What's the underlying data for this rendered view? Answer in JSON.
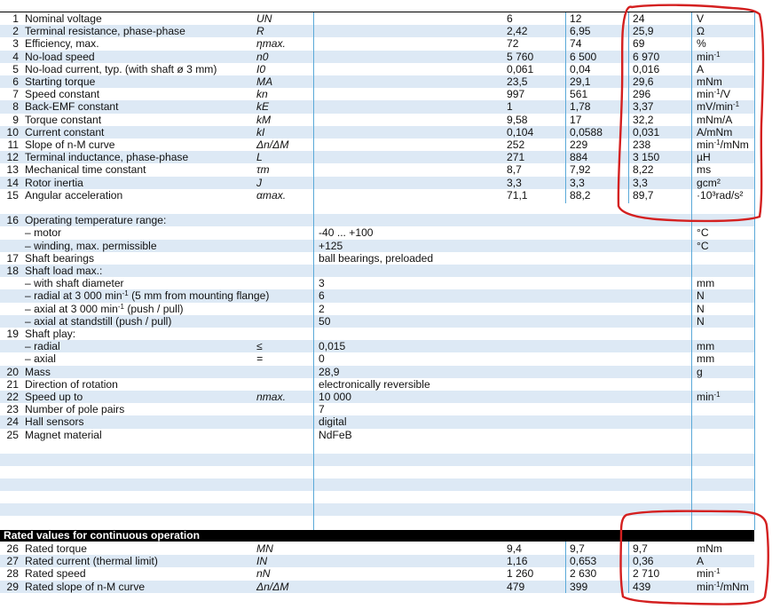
{
  "rows_top": [
    {
      "no": "1",
      "label": "Nominal voltage",
      "sym": "UN",
      "mid": "",
      "v1": "6",
      "v2": "12",
      "v3": "24",
      "unit": "V"
    },
    {
      "no": "2",
      "label": "Terminal resistance, phase-phase",
      "sym": "R",
      "mid": "",
      "v1": "2,42",
      "v2": "6,95",
      "v3": "25,9",
      "unit": "Ω"
    },
    {
      "no": "3",
      "label": "Efficiency, max.",
      "sym": "ηmax.",
      "mid": "",
      "v1": "72",
      "v2": "74",
      "v3": "69",
      "unit": "%"
    },
    {
      "no": "4",
      "label": "No-load speed",
      "sym": "n0",
      "mid": "",
      "v1": "5 760",
      "v2": "6 500",
      "v3": "6 970",
      "unit": "min-1"
    },
    {
      "no": "5",
      "label": "No-load current, typ. (with shaft ø 3 mm)",
      "sym": "I0",
      "mid": "",
      "v1": "0,061",
      "v2": "0,04",
      "v3": "0,016",
      "unit": "A"
    },
    {
      "no": "6",
      "label": "Starting torque",
      "sym": "MA",
      "mid": "",
      "v1": "23,5",
      "v2": "29,1",
      "v3": "29,6",
      "unit": "mNm"
    },
    {
      "no": "7",
      "label": "Speed constant",
      "sym": "kn",
      "mid": "",
      "v1": "997",
      "v2": "561",
      "v3": "296",
      "unit": "min-1/V"
    },
    {
      "no": "8",
      "label": "Back-EMF constant",
      "sym": "kE",
      "mid": "",
      "v1": "1",
      "v2": "1,78",
      "v3": "3,37",
      "unit": "mV/min-1"
    },
    {
      "no": "9",
      "label": "Torque constant",
      "sym": "kM",
      "mid": "",
      "v1": "9,58",
      "v2": "17",
      "v3": "32,2",
      "unit": "mNm/A"
    },
    {
      "no": "10",
      "label": "Current constant",
      "sym": "kI",
      "mid": "",
      "v1": "0,104",
      "v2": "0,0588",
      "v3": "0,031",
      "unit": "A/mNm"
    },
    {
      "no": "11",
      "label": "Slope of n-M curve",
      "sym": "Δn/ΔM",
      "mid": "",
      "v1": "252",
      "v2": "229",
      "v3": "238",
      "unit": "min-1/mNm"
    },
    {
      "no": "12",
      "label": "Terminal inductance, phase-phase",
      "sym": "L",
      "mid": "",
      "v1": "271",
      "v2": "884",
      "v3": "3 150",
      "unit": "µH"
    },
    {
      "no": "13",
      "label": "Mechanical time constant",
      "sym": "τm",
      "mid": "",
      "v1": "8,7",
      "v2": "7,92",
      "v3": "8,22",
      "unit": "ms"
    },
    {
      "no": "14",
      "label": "Rotor inertia",
      "sym": "J",
      "mid": "",
      "v1": "3,3",
      "v2": "3,3",
      "v3": "3,3",
      "unit": "gcm²"
    },
    {
      "no": "15",
      "label": "Angular acceleration",
      "sym": "αmax.",
      "mid": "",
      "v1": "71,1",
      "v2": "88,2",
      "v3": "89,7",
      "unit": "·10³rad/s²"
    }
  ],
  "rows_mid": [
    {
      "no": "",
      "label": "",
      "sym": "",
      "mid": "",
      "unit": ""
    },
    {
      "no": "16",
      "label": "Operating temperature range:",
      "sym": "",
      "mid": "",
      "unit": ""
    },
    {
      "no": "",
      "label": "– motor",
      "sym": "",
      "mid": "-40 ... +100",
      "unit": "°C"
    },
    {
      "no": "",
      "label": "– winding, max. permissible",
      "sym": "",
      "mid": "              +125",
      "unit": "°C"
    },
    {
      "no": "17",
      "label": "Shaft bearings",
      "sym": "",
      "mid": "ball bearings, preloaded",
      "unit": ""
    },
    {
      "no": "18",
      "label": "Shaft load max.:",
      "sym": "",
      "mid": "",
      "unit": ""
    },
    {
      "no": "",
      "label": "– with shaft diameter",
      "sym": "",
      "mid": "3",
      "unit": "mm"
    },
    {
      "no": "",
      "label": "– radial at 3 000 min-1 (5 mm from mounting flange)",
      "sym": "",
      "mid": "6",
      "unit": "N"
    },
    {
      "no": "",
      "label": "– axial at 3 000 min-1 (push / pull)",
      "sym": "",
      "mid": "2",
      "unit": "N"
    },
    {
      "no": "",
      "label": "– axial at standstill (push / pull)",
      "sym": "",
      "mid": "50",
      "unit": "N"
    },
    {
      "no": "19",
      "label": "Shaft play:",
      "sym": "",
      "mid": "",
      "unit": ""
    },
    {
      "no": "",
      "label": "– radial",
      "sym": "≤",
      "mid": "0,015",
      "unit": "mm"
    },
    {
      "no": "",
      "label": "– axial",
      "sym": "=",
      "mid": "0",
      "unit": "mm"
    },
    {
      "no": "20",
      "label": "Mass",
      "sym": "",
      "mid": "28,9",
      "unit": "g"
    },
    {
      "no": "21",
      "label": "Direction of rotation",
      "sym": "",
      "mid": "electronically reversible",
      "unit": ""
    },
    {
      "no": "22",
      "label": "Speed up to",
      "sym": "nmax.",
      "mid": "10 000",
      "unit": "min-1"
    },
    {
      "no": "23",
      "label": "Number of pole pairs",
      "sym": "",
      "mid": "7",
      "unit": ""
    },
    {
      "no": "24",
      "label": "Hall sensors",
      "sym": "",
      "mid": "digital",
      "unit": ""
    },
    {
      "no": "25",
      "label": "Magnet material",
      "sym": "",
      "mid": "NdFeB",
      "unit": ""
    }
  ],
  "section_header": "Rated values for continuous operation",
  "rows_bottom": [
    {
      "no": "26",
      "label": "Rated torque",
      "sym": "MN",
      "v1": "9,4",
      "v2": "9,7",
      "v3": "9,7",
      "unit": "mNm"
    },
    {
      "no": "27",
      "label": "Rated current (thermal limit)",
      "sym": "IN",
      "v1": "1,16",
      "v2": "0,653",
      "v3": "0,36",
      "unit": "A"
    },
    {
      "no": "28",
      "label": "Rated speed",
      "sym": "nN",
      "v1": "1 260",
      "v2": "2 630",
      "v3": "2 710",
      "unit": "min-1"
    },
    {
      "no": "29",
      "label": "Rated slope of n-M curve",
      "sym": "Δn/ΔM",
      "v1": "479",
      "v2": "399",
      "v3": "439",
      "unit": "min-1/mNm"
    }
  ],
  "annotation_color": "#d42020",
  "grid_color": "#5aa9d8",
  "shade_color": "#dde9f5"
}
